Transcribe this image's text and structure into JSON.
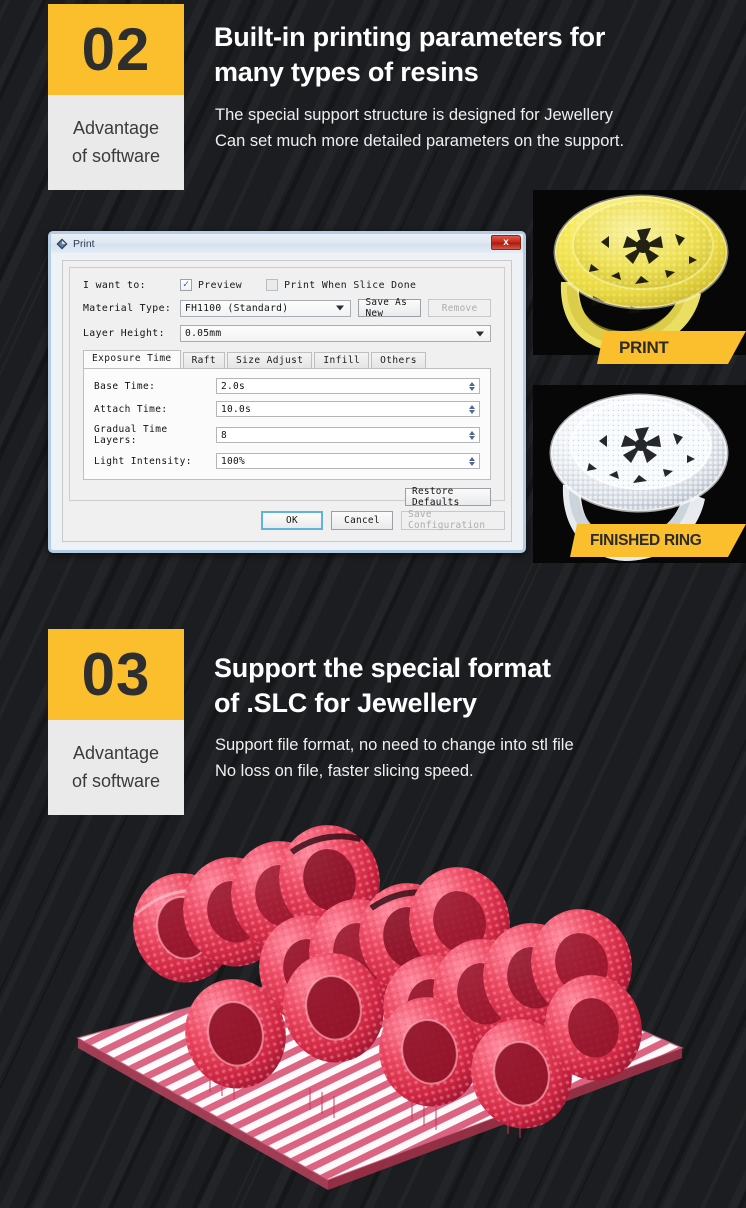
{
  "theme": {
    "background": "#1c1d20",
    "accent_yellow": "#FBBF2E",
    "badge_sub_bg": "#EAEAEA",
    "heading_color": "#ffffff"
  },
  "sections": [
    {
      "badge_number": "02",
      "badge_sub_line1": "Advantage",
      "badge_sub_line2": "of software",
      "title_line1": "Built-in printing parameters for",
      "title_line2": "many types of resins",
      "desc_line1": "The special support structure is designed for Jewellery",
      "desc_line2": "Can set much more detailed parameters on the support."
    },
    {
      "badge_number": "03",
      "badge_sub_line1": "Advantage",
      "badge_sub_line2": "of software",
      "title_line1": "Support the special format",
      "title_line2": "of .SLC for Jewellery",
      "desc_line1": "Support file format, no need to change into stl file",
      "desc_line2": "No loss on file, faster slicing speed."
    }
  ],
  "dialog": {
    "title": "Print",
    "icon": "diamond-app-icon",
    "close_label": "x",
    "i_want_to_label": "I want to:",
    "checkboxes": [
      {
        "label": "Preview",
        "checked": true
      },
      {
        "label": "Print When Slice Done",
        "checked": false
      }
    ],
    "material_type_label": "Material Type:",
    "material_type_value": "FH1100 (Standard)",
    "save_as_new_label": "Save As New",
    "remove_label": "Remove",
    "layer_height_label": "Layer Height:",
    "layer_height_value": "0.05mm",
    "tabs": [
      {
        "label": "Exposure Time",
        "active": true
      },
      {
        "label": "Raft",
        "active": false
      },
      {
        "label": "Size Adjust",
        "active": false
      },
      {
        "label": "Infill",
        "active": false
      },
      {
        "label": "Others",
        "active": false
      }
    ],
    "parameters": [
      {
        "label": "Base Time:",
        "value": "2.0s"
      },
      {
        "label": "Attach Time:",
        "value": "10.0s"
      },
      {
        "label": "Gradual Time Layers:",
        "value": "8"
      },
      {
        "label": "Light Intensity:",
        "value": "100%"
      }
    ],
    "restore_defaults_label": "Restore Defaults",
    "ok_label": "OK",
    "cancel_label": "Cancel",
    "save_configuration_label": "Save Configuration"
  },
  "photos": {
    "print_banner": "PRINT",
    "finished_banner": "FINISHED RING",
    "printed_ring_alt": "yellow-resin-printed-ring",
    "finished_ring_alt": "silver-diamond-finished-ring",
    "print_plate_alt": "red-resin-rings-on-raft-plate"
  }
}
